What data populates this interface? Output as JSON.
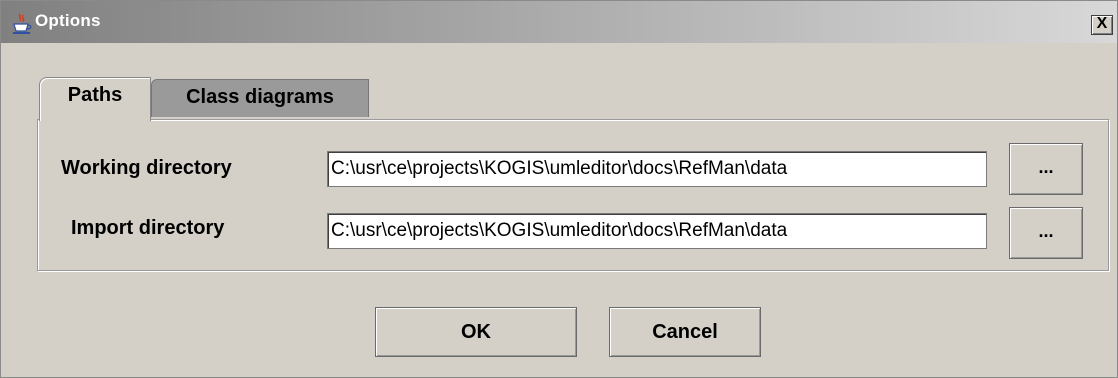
{
  "window": {
    "title": "Options",
    "close_label": "X"
  },
  "tabs": [
    {
      "label": "Paths",
      "selected": true
    },
    {
      "label": "Class diagrams",
      "selected": false
    }
  ],
  "paths": {
    "working": {
      "label": "Working directory",
      "value": "C:\\usr\\ce\\projects\\KOGIS\\umleditor\\docs\\RefMan\\data",
      "browse_label": "..."
    },
    "import": {
      "label": "Import directory",
      "value": "C:\\usr\\ce\\projects\\KOGIS\\umleditor\\docs\\RefMan\\data",
      "browse_label": "..."
    }
  },
  "buttons": {
    "ok": "OK",
    "cancel": "Cancel"
  },
  "icons": {
    "app": "java-cup-icon",
    "close": "close-icon"
  }
}
